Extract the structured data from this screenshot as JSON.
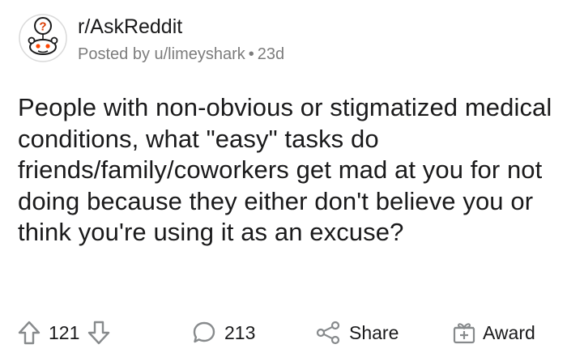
{
  "post": {
    "subreddit": "r/AskReddit",
    "posted_by": "Posted by u/limeyshark",
    "separator": "•",
    "age": "23d",
    "title": "People with non-obvious or stigmatized medical conditions, what \"easy\" tasks do friends/family/coworkers get mad at you for not doing because they either don't believe you or think you're using it as an excuse?"
  },
  "actions": {
    "upvote_icon": "arrow-up-icon",
    "vote_count": "121",
    "downvote_icon": "arrow-down-icon",
    "comment_icon": "comment-bubble-icon",
    "comment_count": "213",
    "share_icon": "share-icon",
    "share_label": "Share",
    "award_icon": "gift-icon",
    "award_label": "Award"
  },
  "colors": {
    "avatar_question_bg": "#d93a00",
    "text_primary": "#1a1a1b",
    "text_secondary": "#7c7c7c",
    "icon_gray": "#878a8c"
  }
}
